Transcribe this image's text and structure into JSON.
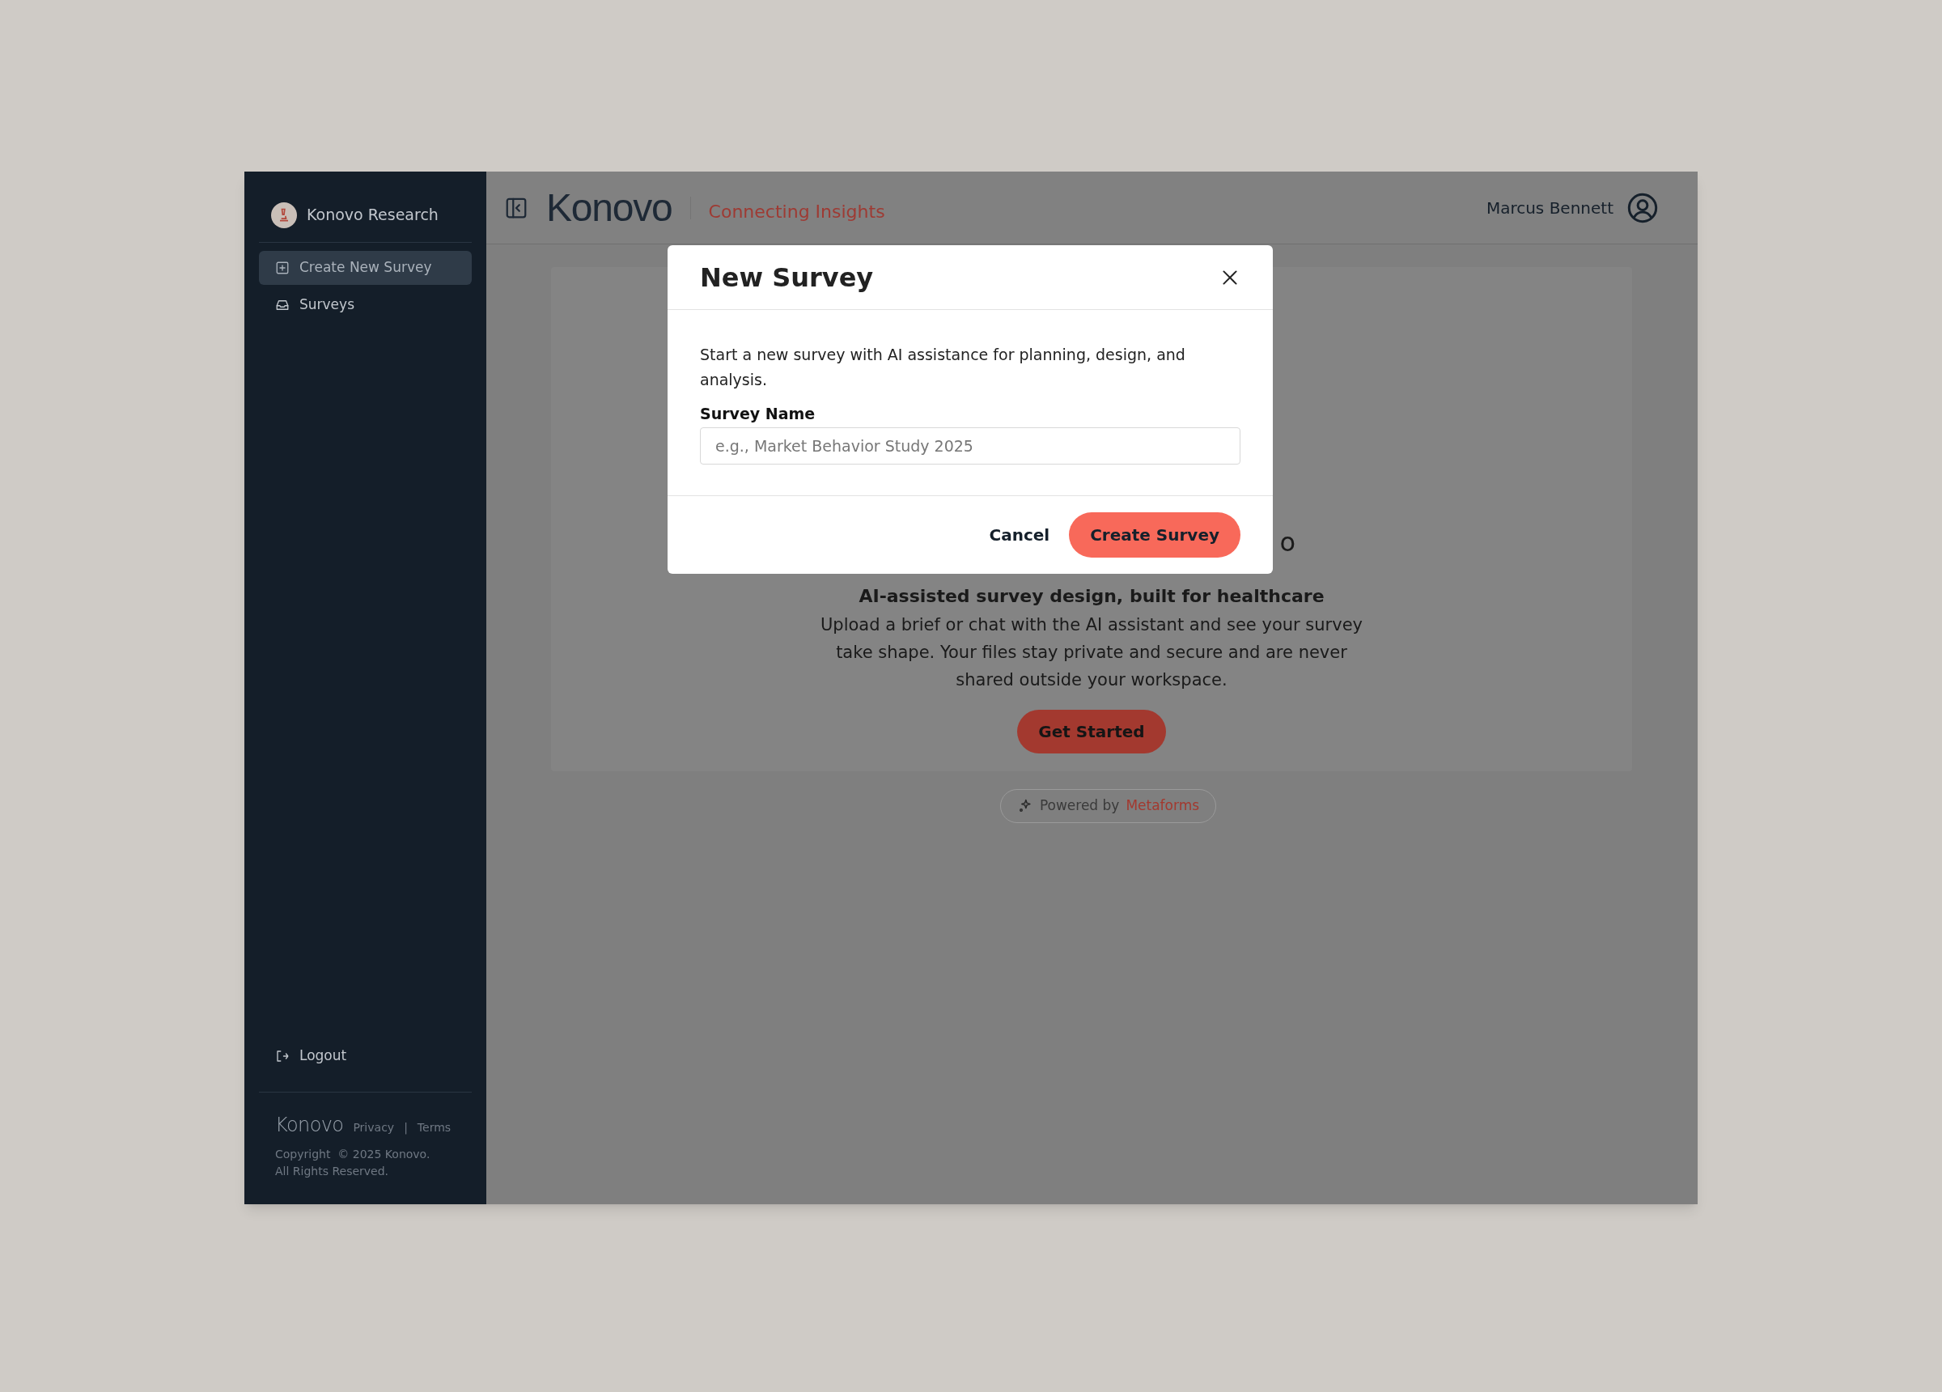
{
  "sidebar": {
    "workspace": "Konovo Research",
    "items": [
      {
        "label": "Create New Survey",
        "kind": "create",
        "selected": true
      },
      {
        "label": "Surveys",
        "kind": "inbox",
        "selected": false
      }
    ],
    "logout": "Logout",
    "footer": {
      "logo": "Konovo",
      "links": [
        "Privacy",
        "Terms"
      ],
      "separator": "|",
      "copyright": "Copyright  © 2025 Konovo.",
      "rights": "All Rights Reserved."
    }
  },
  "header": {
    "logo": "Konovo",
    "tagline": "Connecting Insights",
    "user": "Marcus Bennett"
  },
  "welcome": {
    "heading_visible": "o",
    "subtitle": "AI-assisted survey design, built for healthcare",
    "body": "Upload a brief or chat with the AI assistant and see your survey take shape. Your files stay private and secure and are never shared outside your workspace.",
    "button": "Get Started"
  },
  "powered_by": {
    "text": "Powered by",
    "brand": "Metaforms"
  },
  "dialog": {
    "title": "New Survey",
    "description": "Start a new survey with AI assistance for planning, design, and analysis.",
    "field_label": "Survey Name",
    "placeholder": "e.g., Market Behavior Study 2025",
    "buttons": [
      {
        "label": "Cancel",
        "kind": "secondary"
      },
      {
        "label": "Create Survey",
        "kind": "primary"
      }
    ]
  }
}
